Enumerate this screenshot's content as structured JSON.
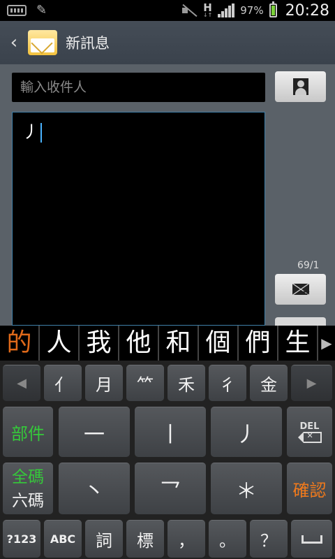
{
  "status_bar": {
    "battery_percent": "97%",
    "network_type": "H",
    "network_sub": "↓↑",
    "time": "20:28",
    "icons": [
      "keyboard-icon",
      "pen-icon",
      "mute-icon",
      "signal-icon",
      "battery-icon"
    ]
  },
  "action_bar": {
    "title": "新訊息",
    "icons": [
      "back-icon",
      "messages-app-icon"
    ]
  },
  "compose": {
    "recipient_placeholder": "輸入收件人",
    "message_text": "丿",
    "char_counter": "69/1"
  },
  "candidates": {
    "items": [
      "的",
      "人",
      "我",
      "他",
      "和",
      "個",
      "們",
      "生"
    ],
    "more_glyph": "▶"
  },
  "keyboard": {
    "row1": {
      "left_glyph": "◀",
      "keys": [
        "亻",
        "月",
        "⺮",
        "禾",
        "彳",
        "金"
      ],
      "right_glyph": "▶"
    },
    "row2": {
      "radical_key": "部件",
      "keys": [
        "一",
        "丨",
        "丿"
      ],
      "del_label": "DEL"
    },
    "row3": {
      "mode_top": "全碼",
      "mode_bottom": "六碼",
      "keys": [
        "丶",
        "乛",
        "＊"
      ],
      "confirm": "確認"
    },
    "row4": {
      "keys": [
        "?123",
        "ABC",
        "詞",
        "標",
        "，",
        "。",
        "？"
      ]
    },
    "accent_green": "#35c93a",
    "accent_orange": "#f07a1c"
  }
}
